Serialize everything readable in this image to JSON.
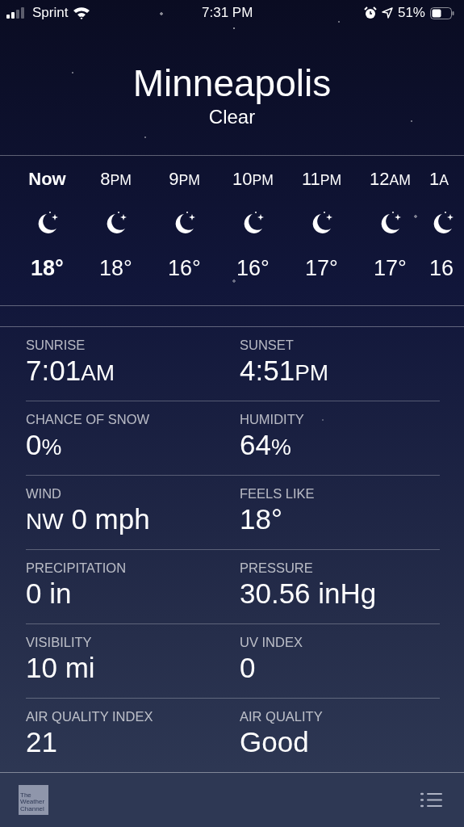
{
  "status_bar": {
    "carrier": "Sprint",
    "time": "7:31 PM",
    "battery": "51%"
  },
  "location": {
    "city": "Minneapolis",
    "condition": "Clear"
  },
  "hourly": [
    {
      "kind": "now",
      "label": "Now",
      "temp": "18°"
    },
    {
      "kind": "hour",
      "label": "8",
      "ampm": "PM",
      "temp": "18°"
    },
    {
      "kind": "hour",
      "label": "9",
      "ampm": "PM",
      "temp": "16°"
    },
    {
      "kind": "hour",
      "label": "10",
      "ampm": "PM",
      "temp": "16°"
    },
    {
      "kind": "hour",
      "label": "11",
      "ampm": "PM",
      "temp": "17°"
    },
    {
      "kind": "hour",
      "label": "12",
      "ampm": "AM",
      "temp": "17°"
    },
    {
      "kind": "hour",
      "label": "1",
      "ampm": "A",
      "temp": "16"
    }
  ],
  "details": [
    [
      {
        "label": "SUNRISE",
        "value": [
          {
            "t": "7:01"
          },
          {
            "t": "AM",
            "small": true
          }
        ]
      },
      {
        "label": "SUNSET",
        "value": [
          {
            "t": "4:51"
          },
          {
            "t": "PM",
            "small": true
          }
        ]
      }
    ],
    [
      {
        "label": "CHANCE OF SNOW",
        "value": [
          {
            "t": "0"
          },
          {
            "t": "%",
            "small": true
          }
        ]
      },
      {
        "label": "HUMIDITY",
        "value": [
          {
            "t": "64"
          },
          {
            "t": "%",
            "small": true
          }
        ]
      }
    ],
    [
      {
        "label": "WIND",
        "value": [
          {
            "t": "NW",
            "small": true
          },
          {
            "t": " 0 mph"
          }
        ]
      },
      {
        "label": "FEELS LIKE",
        "value": [
          {
            "t": "18°"
          }
        ]
      }
    ],
    [
      {
        "label": "PRECIPITATION",
        "value": [
          {
            "t": "0 in"
          }
        ]
      },
      {
        "label": "PRESSURE",
        "value": [
          {
            "t": "30.56 inHg"
          }
        ]
      }
    ],
    [
      {
        "label": "VISIBILITY",
        "value": [
          {
            "t": "10 mi"
          }
        ]
      },
      {
        "label": "UV INDEX",
        "value": [
          {
            "t": "0"
          }
        ]
      }
    ],
    [
      {
        "label": "AIR QUALITY INDEX",
        "value": [
          {
            "t": "21"
          }
        ]
      },
      {
        "label": "AIR QUALITY",
        "value": [
          {
            "t": "Good"
          }
        ]
      }
    ]
  ],
  "footer": {
    "logo_lines": [
      "The",
      "Weather",
      "Channel"
    ]
  }
}
